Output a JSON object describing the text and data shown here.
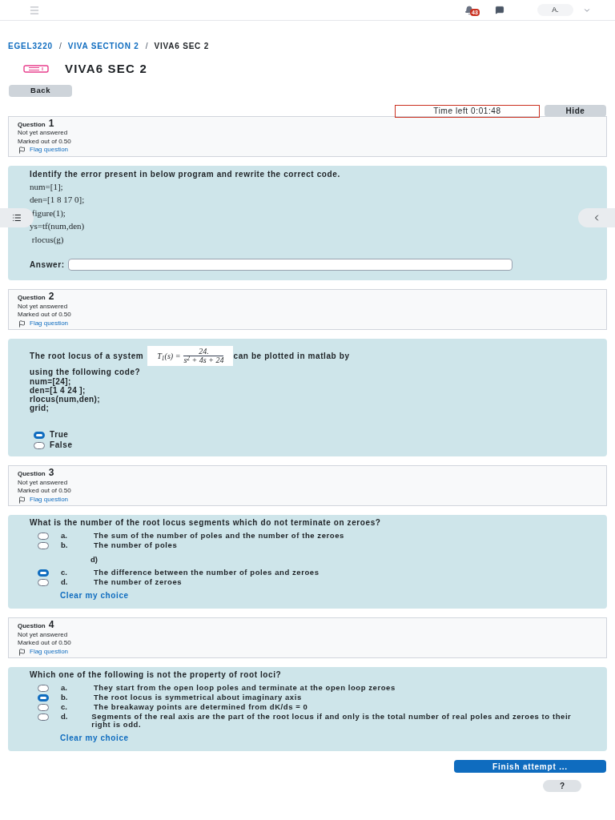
{
  "header": {
    "notification_count": "43",
    "avatar": "A."
  },
  "breadcrumb": [
    {
      "label": "EGEL3220",
      "link": true
    },
    {
      "kind": "separator",
      "label": "/"
    },
    {
      "label": "VIVA SECTION 2",
      "link": true
    },
    {
      "kind": "separator",
      "label": "/"
    },
    {
      "label": "VIVA6 SEC 2",
      "link": false
    }
  ],
  "left_drawer": {
    "open": false
  },
  "right_drawer": {
    "open": false
  },
  "title": "VIVA6 SEC 2",
  "back_button": "Back",
  "timer": {
    "text": "Time left 0:01:48",
    "hide_button": "Hide"
  },
  "questions": [
    {
      "kind": "shortanswer",
      "number_label": "Question",
      "number": "1",
      "status": "Not yet answered",
      "marks": "Marked out of 0.50",
      "flag": "Flag question",
      "prompt": "Identify the error present in below program and rewrite the correct code.",
      "code_lines": [
        "num=[1];",
        "den=[1 8 17 0];",
        " figure(1);",
        "ys=tf(num,den)",
        " rlocus(g)"
      ],
      "answer_label": "Answer:"
    },
    {
      "kind": "truefalse",
      "number_label": "Question",
      "number": "2",
      "status": "Not yet answered",
      "marks": "Marked out of 0.50",
      "flag": "Flag question",
      "prompt_before": "The root locus of a system",
      "formula": {
        "lhs": "T$_{1}$(s) =",
        "numerator": "24.",
        "denominator": "s$^{2}$ + 4s + 24"
      },
      "prompt_after": "can be plotted in matlab by",
      "prompt_rest": "using the following code?",
      "code_lines": [
        "num=[24];",
        "den=[1 4 24 ];",
        "rlocus(num,den);",
        "grid;"
      ],
      "options": [
        {
          "kind": "option",
          "label": "True",
          "selected": true
        },
        {
          "kind": "option",
          "label": "False",
          "selected": false
        }
      ]
    },
    {
      "kind": "multichoice",
      "number_label": "Question",
      "number": "3",
      "status": "Not yet answered",
      "marks": "Marked out of 0.50",
      "flag": "Flag question",
      "prompt": "What is the number of the root locus segments which do not terminate on zeroes?",
      "options": [
        {
          "kind": "option",
          "letter": "a.",
          "label": "The sum of the number of poles and the number of the zeroes",
          "selected": false
        },
        {
          "kind": "option",
          "letter": "b.",
          "label": "The number of poles",
          "selected": false
        },
        {
          "kind": "note",
          "label": "d)"
        },
        {
          "kind": "option",
          "letter": "c.",
          "label": "The difference between the number of poles and zeroes",
          "selected": true
        },
        {
          "kind": "option",
          "letter": "d.",
          "label": "The number of zeroes",
          "selected": false
        }
      ],
      "clear": "Clear my choice"
    },
    {
      "kind": "multichoice",
      "number_label": "Question",
      "number": "4",
      "status": "Not yet answered",
      "marks": "Marked out of 0.50",
      "flag": "Flag question",
      "prompt": "Which one of the following is not the property of root loci?",
      "options": [
        {
          "kind": "option",
          "letter": "a.",
          "label": "They start from the open loop poles and terminate at the open loop zeroes",
          "selected": false
        },
        {
          "kind": "option",
          "letter": "b.",
          "label": "The root locus is symmetrical about imaginary axis",
          "selected": true
        },
        {
          "kind": "option",
          "letter": "c.",
          "label": "The breakaway points are determined from dK/ds = 0",
          "selected": false
        },
        {
          "kind": "option",
          "letter": "d.",
          "label": "Segments of the real axis are the part of the root locus if and only is the total number of real poles and zeroes to their right is odd.",
          "selected": false
        }
      ],
      "clear": "Clear my choice"
    }
  ],
  "finish_button": "Finish attempt ...",
  "help_button": "?"
}
